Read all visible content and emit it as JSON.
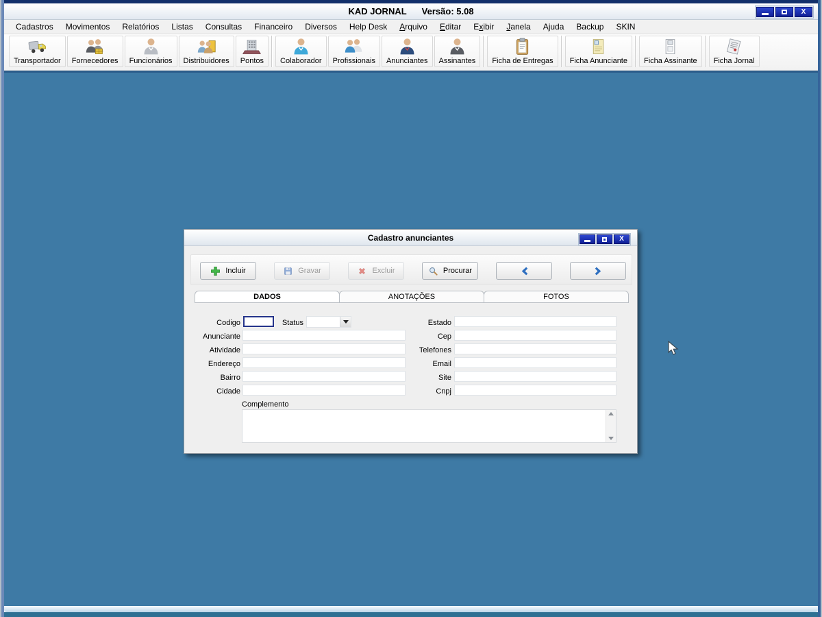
{
  "window": {
    "title": "KAD JORNAL",
    "version_label": "Versão: 5.08",
    "controls": {
      "close_glyph": "X"
    }
  },
  "colors": {
    "desktop_blue": "#3e7aa5",
    "titlebar_button_blue": "#17269e",
    "frame_navy": "#12306b",
    "frame_teal": "#2e7093",
    "incluir_green": "#43b649",
    "excluir_red": "#d6352b",
    "save_blue": "#3a6ebf",
    "arrow_blue": "#2e6fc0"
  },
  "menu": {
    "items": [
      {
        "pre": "Cadastros",
        "u": "",
        "rest": ""
      },
      {
        "pre": "Movimentos",
        "u": "",
        "rest": ""
      },
      {
        "pre": "Relatórios",
        "u": "",
        "rest": ""
      },
      {
        "pre": "Listas",
        "u": "",
        "rest": ""
      },
      {
        "pre": "Consultas",
        "u": "",
        "rest": ""
      },
      {
        "pre": "Financeiro",
        "u": "",
        "rest": ""
      },
      {
        "pre": "Diversos",
        "u": "",
        "rest": ""
      },
      {
        "pre": "Help Desk",
        "u": "",
        "rest": ""
      },
      {
        "pre": "",
        "u": "A",
        "rest": "rquivo"
      },
      {
        "pre": "",
        "u": "E",
        "rest": "ditar"
      },
      {
        "pre": "E",
        "u": "x",
        "rest": "ibir"
      },
      {
        "pre": "",
        "u": "J",
        "rest": "anela"
      },
      {
        "pre": "Ajuda",
        "u": "",
        "rest": ""
      },
      {
        "pre": "Backup",
        "u": "",
        "rest": ""
      },
      {
        "pre": "SKIN",
        "u": "",
        "rest": ""
      }
    ]
  },
  "toolbar": {
    "buttons": [
      {
        "label": "Transportador",
        "icon": "truck-icon"
      },
      {
        "label": "Fornecedores",
        "icon": "suppliers-people-icon"
      },
      {
        "label": "Funcionários",
        "icon": "employee-person-icon"
      },
      {
        "label": "Distribuidores",
        "icon": "distributors-people-icon"
      },
      {
        "label": "Pontos",
        "icon": "building-icon"
      },
      {
        "label": "Colaborador",
        "icon": "collaborator-person-icon"
      },
      {
        "label": "Profissionais",
        "icon": "professionals-people-icon"
      },
      {
        "label": "Anunciantes",
        "icon": "advertiser-person-icon"
      },
      {
        "label": "Assinantes",
        "icon": "subscriber-person-icon"
      },
      {
        "label": "Ficha de Entregas",
        "icon": "clipboard-icon"
      },
      {
        "label": "Ficha Anunciante",
        "icon": "document-yellow-icon"
      },
      {
        "label": "Ficha Assinante",
        "icon": "document-gray-icon"
      },
      {
        "label": "Ficha Jornal",
        "icon": "newspaper-icon"
      }
    ]
  },
  "dialog": {
    "title": "Cadastro anunciantes",
    "toolbar": {
      "buttons": [
        {
          "label": "Incluir",
          "icon": "plus-icon",
          "enabled": true
        },
        {
          "label": "Gravar",
          "icon": "save-floppy-icon",
          "enabled": false
        },
        {
          "label": "Excluir",
          "icon": "delete-x-icon",
          "enabled": false
        },
        {
          "label": "Procurar",
          "icon": "search-magnifier-icon",
          "enabled": true
        },
        {
          "label": "",
          "icon": "arrow-left-icon",
          "enabled": true
        },
        {
          "label": "",
          "icon": "arrow-right-icon",
          "enabled": true
        }
      ]
    },
    "tabs": [
      {
        "label": "DADOS",
        "active": true
      },
      {
        "label": "ANOTAÇÕES",
        "active": false
      },
      {
        "label": "FOTOS",
        "active": false
      }
    ],
    "form": {
      "codigo": {
        "label": "Codigo",
        "value": ""
      },
      "status": {
        "label": "Status",
        "value": ""
      },
      "rows_left": [
        {
          "label": "Anunciante",
          "value": ""
        },
        {
          "label": "Atividade",
          "value": ""
        },
        {
          "label": "Endereço",
          "value": ""
        },
        {
          "label": "Bairro",
          "value": ""
        },
        {
          "label": "Cidade",
          "value": ""
        }
      ],
      "rows_right": [
        {
          "label": "Estado",
          "value": ""
        },
        {
          "label": "Cep",
          "value": ""
        },
        {
          "label": "Telefones",
          "value": ""
        },
        {
          "label": "Email",
          "value": ""
        },
        {
          "label": "Site",
          "value": ""
        },
        {
          "label": "Cnpj",
          "value": ""
        }
      ],
      "complemento": {
        "label": "Complemento",
        "value": ""
      }
    }
  }
}
